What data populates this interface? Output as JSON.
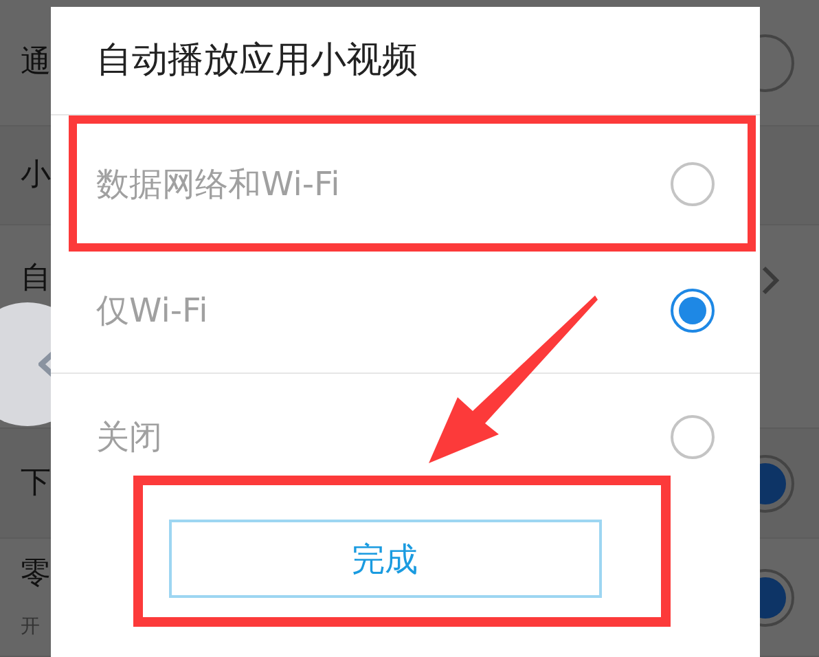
{
  "background_list": [
    {
      "label": "通",
      "kind": "toggle",
      "on": false
    },
    {
      "label": "小",
      "kind": "none"
    },
    {
      "label": "自",
      "kind": "chevron"
    },
    {
      "label": "下",
      "kind": "toggle",
      "on": true
    },
    {
      "label": "零",
      "kind": "toggle",
      "on": true,
      "subtitle": "开"
    }
  ],
  "dialog": {
    "title": "自动播放应用小视频",
    "options": [
      {
        "label": "数据网络和Wi-Fi",
        "selected": false
      },
      {
        "label": "仅Wi-Fi",
        "selected": true
      },
      {
        "label": "关闭",
        "selected": false
      }
    ],
    "button": "完成"
  }
}
